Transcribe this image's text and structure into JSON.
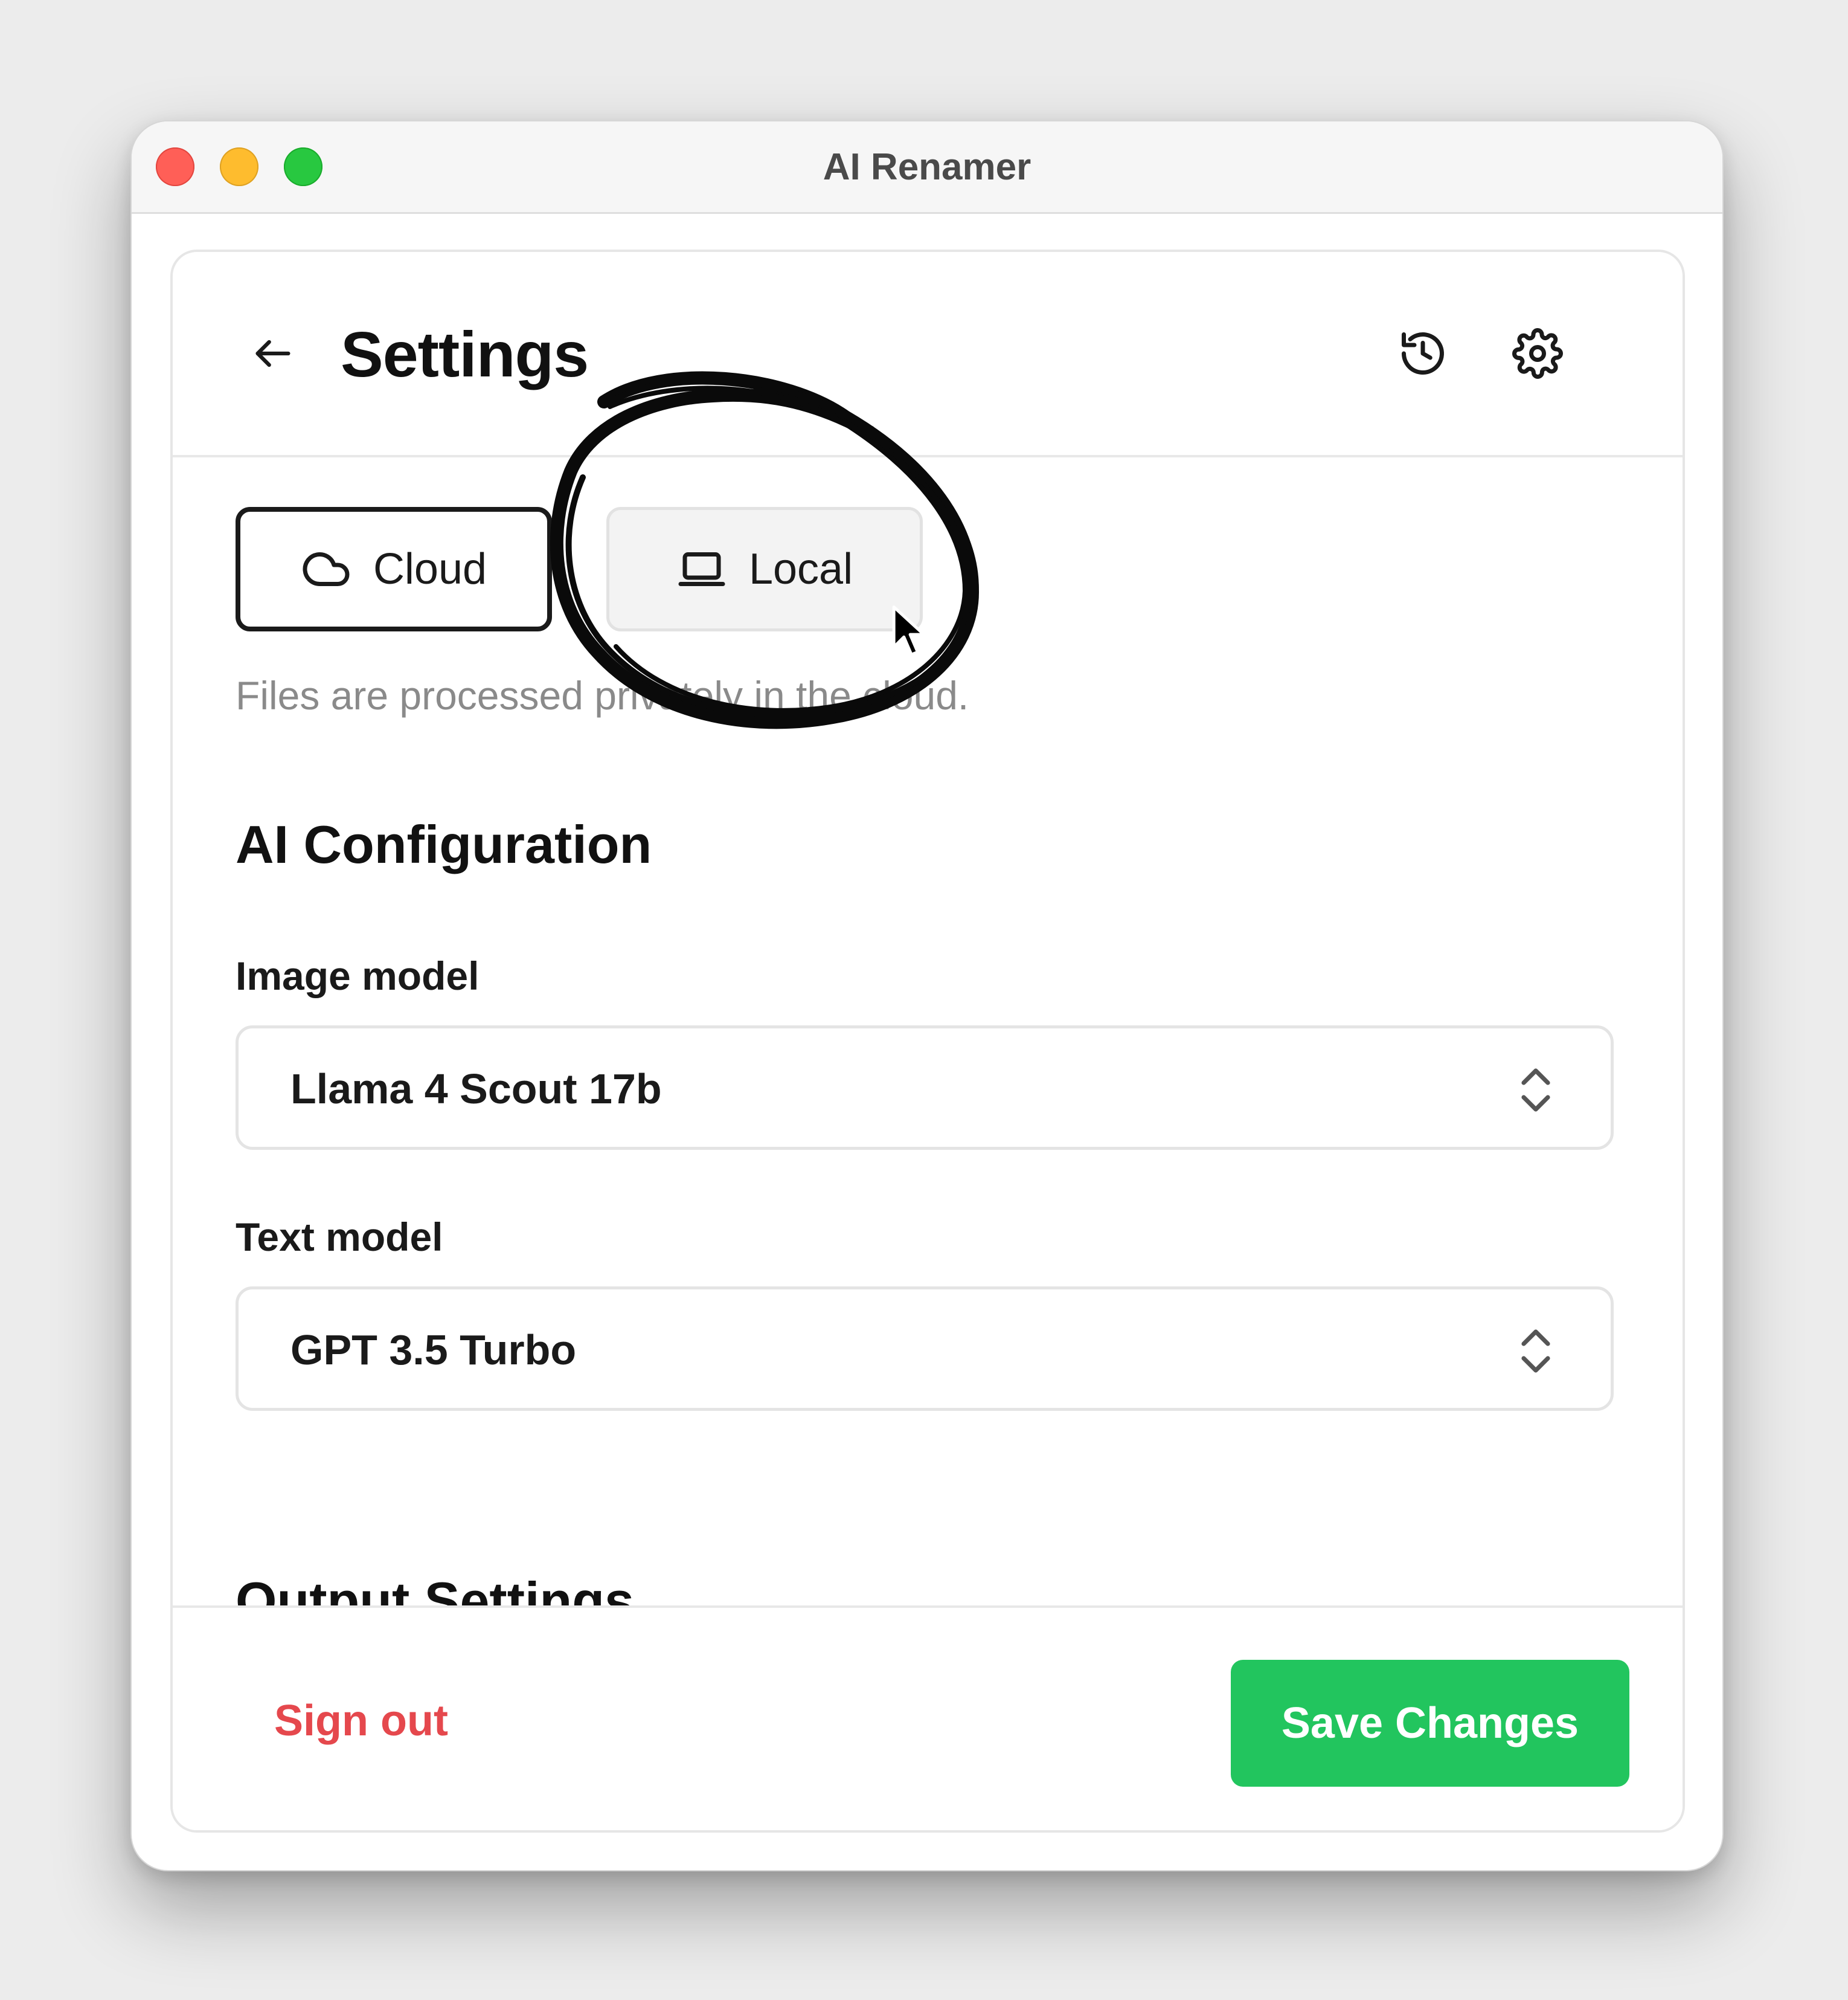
{
  "window": {
    "title": "AI Renamer"
  },
  "header": {
    "title": "Settings",
    "back_icon": "arrow-left-icon",
    "history_icon": "history-icon",
    "settings_icon": "gear-icon"
  },
  "processing_mode": {
    "options": [
      {
        "label": "Cloud",
        "icon": "cloud-icon",
        "selected": true
      },
      {
        "label": "Local",
        "icon": "laptop-icon",
        "selected": false
      }
    ],
    "description": "Files are processed privately in the cloud."
  },
  "ai_configuration": {
    "title": "AI Configuration",
    "image_model": {
      "label": "Image model",
      "value": "Llama 4 Scout 17b"
    },
    "text_model": {
      "label": "Text model",
      "value": "GPT 3.5 Turbo"
    }
  },
  "next_section": {
    "title": "Output Settings"
  },
  "footer": {
    "sign_out_label": "Sign out",
    "save_label": "Save Changes"
  },
  "colors": {
    "accent_green": "#22c55e",
    "danger_red": "#e5484d",
    "text_primary": "#111111",
    "text_muted": "#8a8a8a"
  }
}
